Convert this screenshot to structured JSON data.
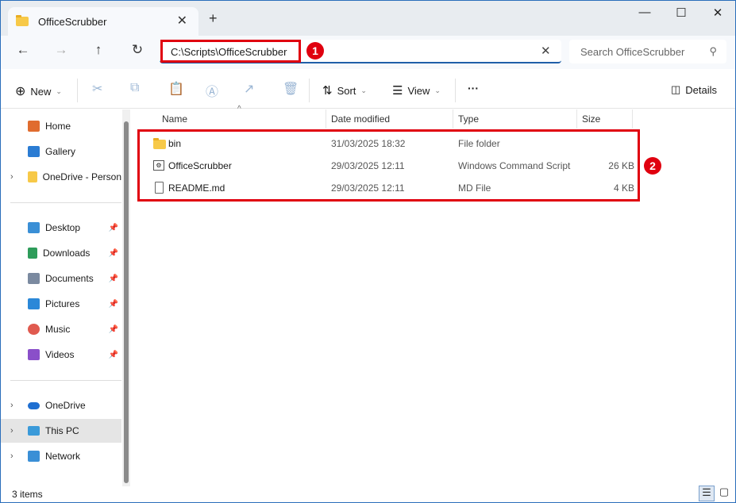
{
  "tab": {
    "title": "OfficeScrubber"
  },
  "address": {
    "path": "C:\\Scripts\\OfficeScrubber",
    "search_placeholder": "Search OfficeScrubber"
  },
  "annotations": [
    "1",
    "2"
  ],
  "toolbar": {
    "new": "New",
    "sort": "Sort",
    "view": "View",
    "more": "···",
    "details": "Details"
  },
  "sidebar": {
    "items": [
      {
        "label": "Home",
        "color": "#e06c2f"
      },
      {
        "label": "Gallery",
        "color": "#2b7cd3"
      },
      {
        "label": "OneDrive - Person",
        "color": "#f7c948"
      },
      {
        "label": "Desktop",
        "color": "#3a8fd6"
      },
      {
        "label": "Downloads",
        "color": "#2e9c5a"
      },
      {
        "label": "Documents",
        "color": "#7b8aa0"
      },
      {
        "label": "Pictures",
        "color": "#2b88d8"
      },
      {
        "label": "Music",
        "color": "#e05a4f"
      },
      {
        "label": "Videos",
        "color": "#8a4fc9"
      },
      {
        "label": "OneDrive",
        "color": "#1f6fd1"
      },
      {
        "label": "This PC",
        "color": "#3a9ad9"
      },
      {
        "label": "Network",
        "color": "#3a8fd6"
      }
    ]
  },
  "columns": {
    "name": "Name",
    "date": "Date modified",
    "type": "Type",
    "size": "Size"
  },
  "files": [
    {
      "name": "bin",
      "date": "31/03/2025 18:32",
      "type": "File folder",
      "size": ""
    },
    {
      "name": "OfficeScrubber",
      "date": "29/03/2025 12:11",
      "type": "Windows Command Script",
      "size": "26 KB"
    },
    {
      "name": "README.md",
      "date": "29/03/2025 12:11",
      "type": "MD File",
      "size": "4 KB"
    }
  ],
  "status": {
    "count": "3 items"
  }
}
